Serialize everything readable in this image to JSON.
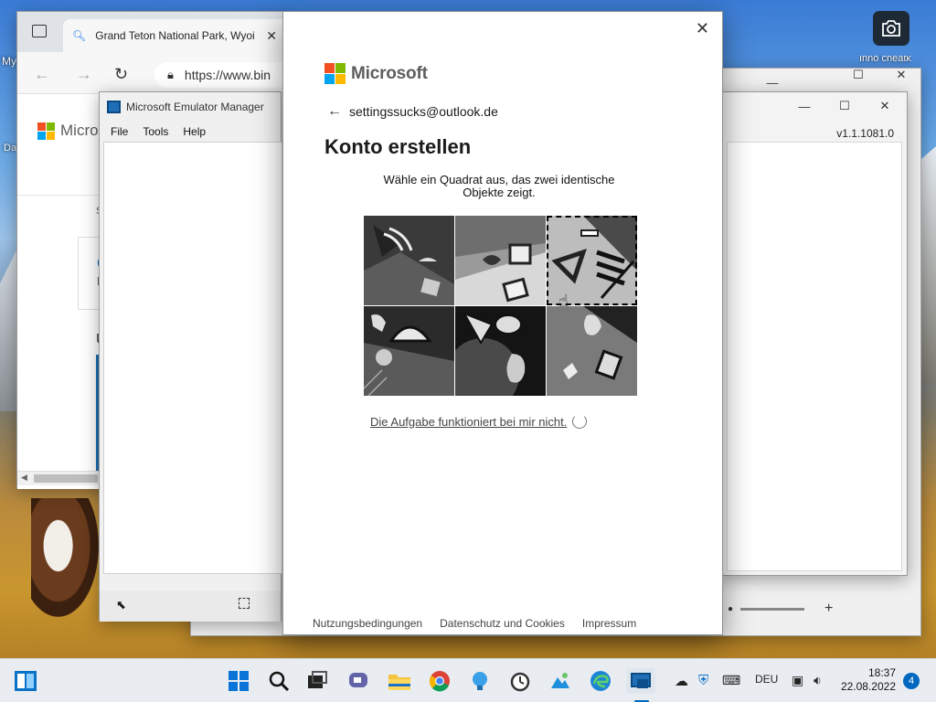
{
  "desktop": {
    "left_icon_labels": [
      "My",
      "Da"
    ],
    "right_icon_label": "Inno cheatk"
  },
  "browser": {
    "tab_title": "Grand Teton National Park, Wyoi",
    "url": "https://www.bin",
    "page_brand": "Micros",
    "page_snippets": [
      "S",
      "C",
      "H",
      "U"
    ]
  },
  "emulator": {
    "title": "Microsoft Emulator Manager",
    "menu": [
      "File",
      "Tools",
      "Help"
    ]
  },
  "right_window": {
    "version": "v1.1.1081.0"
  },
  "dialog": {
    "brand": "Microsoft",
    "identity": "settingssucks@outlook.de",
    "title": "Konto erstellen",
    "instruction": "Wähle ein Quadrat aus, das zwei identische Objekte zeigt.",
    "trouble_link": "Die Aufgabe funktioniert bei mir nicht.",
    "footer_links": [
      "Nutzungsbedingungen",
      "Datenschutz und Cookies",
      "Impressum"
    ],
    "captcha_tiles": [
      {
        "id": 1,
        "selected": false
      },
      {
        "id": 2,
        "selected": false
      },
      {
        "id": 3,
        "selected": true
      },
      {
        "id": 4,
        "selected": false
      },
      {
        "id": 5,
        "selected": false
      },
      {
        "id": 6,
        "selected": false
      }
    ]
  },
  "ms_logo_colors": [
    "#f25022",
    "#7fba00",
    "#00a4ef",
    "#ffb900"
  ],
  "taskbar": {
    "language": "DEU",
    "time": "18:37",
    "date": "22.08.2022",
    "notification_count": "4"
  }
}
